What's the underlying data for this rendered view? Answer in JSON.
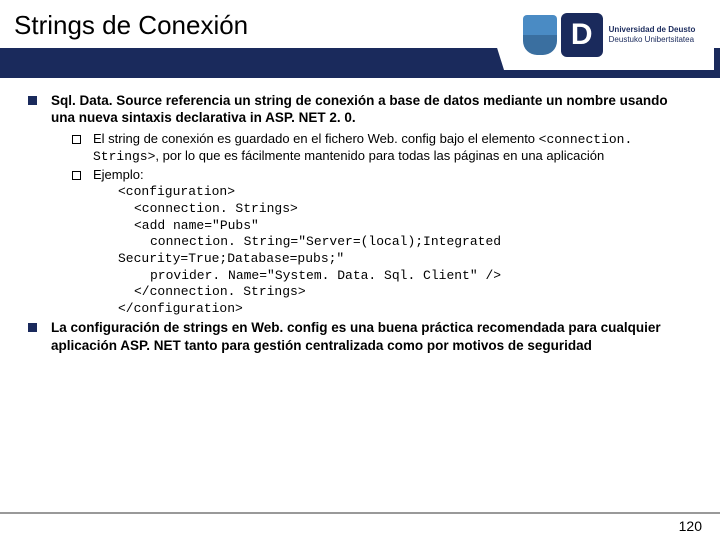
{
  "title": "Strings de Conexión",
  "logo": {
    "letter": "D",
    "line1": "Universidad de Deusto",
    "line2": "Deustuko Unibertsitatea"
  },
  "bullets": [
    {
      "text": "Sql. Data. Source referencia un string de conexión a base de datos mediante un nombre usando una nueva sintaxis declarativa in ASP. NET 2. 0.",
      "subs": [
        {
          "pre": "El string de conexión es guardado en el fichero Web. config bajo el elemento ",
          "code": "<connection. Strings>",
          "post": ", por lo que es fácilmente mantenido para todas las páginas en una aplicación"
        },
        {
          "pre": "Ejemplo:",
          "code": "",
          "post": ""
        }
      ]
    },
    {
      "text": "La configuración de strings en Web. config es una buena práctica recomendada para cualquier aplicación ASP. NET tanto para gestión centralizada como por motivos de seguridad"
    }
  ],
  "code": {
    "l1": "<configuration>",
    "l2": "<connection. Strings>",
    "l3": "<add name=\"Pubs\"",
    "l4": "connection. String=\"Server=(local);Integrated",
    "l5": "Security=True;Database=pubs;\"",
    "l6": "provider. Name=\"System. Data. Sql. Client\" />",
    "l7": "</connection. Strings>",
    "l8": "</configuration>"
  },
  "page": "120"
}
